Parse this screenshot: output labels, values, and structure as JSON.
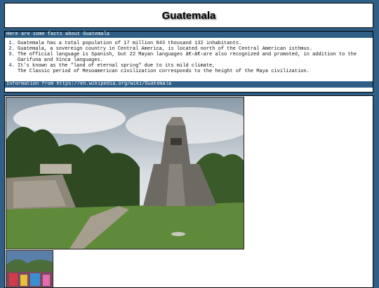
{
  "page": {
    "title": "Guatemala"
  },
  "facts": {
    "intro": "Here are some facts about Guatemala",
    "items": [
      "Guatemala has a total population of 17 million 843 thousand 132 inhabitants.",
      "Guatemala, a sovereign country in Central America, is located north of the Central American isthmus.",
      "The official language is Spanish, but 22 Mayan languages â€‹â€‹are also recognized and promoted, in addition to the Garifuna and Xinca languages.",
      "It's known as the \"land of eternal spring\" due to its mild climate,"
    ],
    "item4_continuation": "The Classic period of Mesoamerican civilization corresponds to the height of the Maya civilization.",
    "source": "Information from https://en.wikipedia.org/wiki/Guatemala"
  },
  "colors": {
    "accent": "#2f5f86",
    "panel": "#ffffff"
  }
}
